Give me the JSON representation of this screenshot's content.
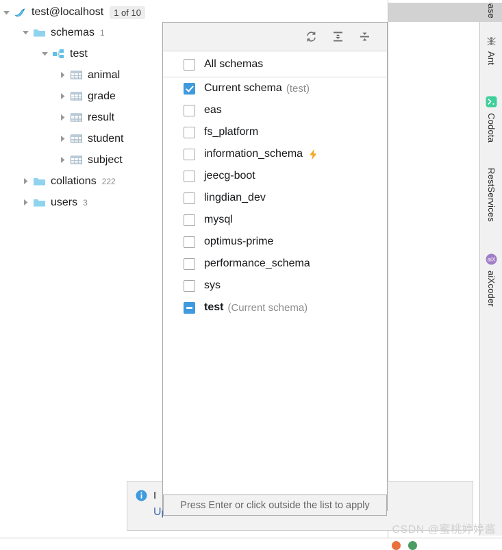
{
  "window": {
    "connection_title": "test@localhost",
    "connection_badge": "1 of 10",
    "connection_icon": "mysql-dolphin-icon"
  },
  "tree": {
    "nodes": [
      {
        "label": "schemas",
        "count": "1",
        "icon": "folder-icon",
        "expanded": true,
        "indent": 1
      },
      {
        "label": "test",
        "count": "",
        "icon": "schema-icon",
        "expanded": true,
        "indent": 2
      },
      {
        "label": "animal",
        "count": "",
        "icon": "table-icon",
        "expanded": false,
        "indent": 3
      },
      {
        "label": "grade",
        "count": "",
        "icon": "table-icon",
        "expanded": false,
        "indent": 3
      },
      {
        "label": "result",
        "count": "",
        "icon": "table-icon",
        "expanded": false,
        "indent": 3
      },
      {
        "label": "student",
        "count": "",
        "icon": "table-icon",
        "expanded": false,
        "indent": 3
      },
      {
        "label": "subject",
        "count": "",
        "icon": "table-icon",
        "expanded": false,
        "indent": 3
      },
      {
        "label": "collations",
        "count": "222",
        "icon": "folder-icon",
        "expanded": false,
        "indent": 1
      },
      {
        "label": "users",
        "count": "3",
        "icon": "folder-icon",
        "expanded": false,
        "indent": 1
      }
    ]
  },
  "popup": {
    "toolbar": [
      {
        "name": "refresh-icon",
        "title": "Refresh"
      },
      {
        "name": "expand-all-icon",
        "title": "Expand All"
      },
      {
        "name": "collapse-all-icon",
        "title": "Collapse All"
      }
    ],
    "options": [
      {
        "label": "All schemas",
        "note": "",
        "state": "unchecked",
        "bolt": false,
        "strong": false,
        "separator_below": true
      },
      {
        "label": "Current schema",
        "note": "(test)",
        "state": "checked",
        "bolt": false,
        "strong": false,
        "separator_below": false
      },
      {
        "label": "eas",
        "note": "",
        "state": "unchecked",
        "bolt": false,
        "strong": false,
        "separator_below": false
      },
      {
        "label": "fs_platform",
        "note": "",
        "state": "unchecked",
        "bolt": false,
        "strong": false,
        "separator_below": false
      },
      {
        "label": "information_schema",
        "note": "",
        "state": "unchecked",
        "bolt": true,
        "strong": false,
        "separator_below": false
      },
      {
        "label": "jeecg-boot",
        "note": "",
        "state": "unchecked",
        "bolt": false,
        "strong": false,
        "separator_below": false
      },
      {
        "label": "lingdian_dev",
        "note": "",
        "state": "unchecked",
        "bolt": false,
        "strong": false,
        "separator_below": false
      },
      {
        "label": "mysql",
        "note": "",
        "state": "unchecked",
        "bolt": false,
        "strong": false,
        "separator_below": false
      },
      {
        "label": "optimus-prime",
        "note": "",
        "state": "unchecked",
        "bolt": false,
        "strong": false,
        "separator_below": false
      },
      {
        "label": "performance_schema",
        "note": "",
        "state": "unchecked",
        "bolt": false,
        "strong": false,
        "separator_below": false
      },
      {
        "label": "sys",
        "note": "",
        "state": "unchecked",
        "bolt": false,
        "strong": false,
        "separator_below": false
      },
      {
        "label": "test",
        "note": "(Current schema)",
        "state": "indeterminate",
        "bolt": false,
        "strong": true,
        "separator_below": false
      }
    ]
  },
  "tooltip": {
    "text": "Press Enter or click outside the list to apply"
  },
  "notification": {
    "icon": "info-icon",
    "message": "I",
    "link": "Update..."
  },
  "right_sidebar": {
    "top_tab": "base",
    "tabs": [
      {
        "label": "Ant",
        "icon": "ant-icon"
      },
      {
        "label": "Codota",
        "icon": "codota-icon"
      },
      {
        "label": "RestServices",
        "icon": ""
      },
      {
        "label": "aiXcoder",
        "icon": "aixcoder-icon"
      }
    ]
  },
  "watermark": {
    "text": "CSDN @蜜桃婷婷酱"
  },
  "colors": {
    "accent_blue": "#3f9ade",
    "folder_blue": "#8fd3ef",
    "bolt_orange": "#f5a623",
    "link_blue": "#3a66b0",
    "codota_green": "#3ecf9a",
    "aixcoder_purple": "#a07cc6"
  }
}
